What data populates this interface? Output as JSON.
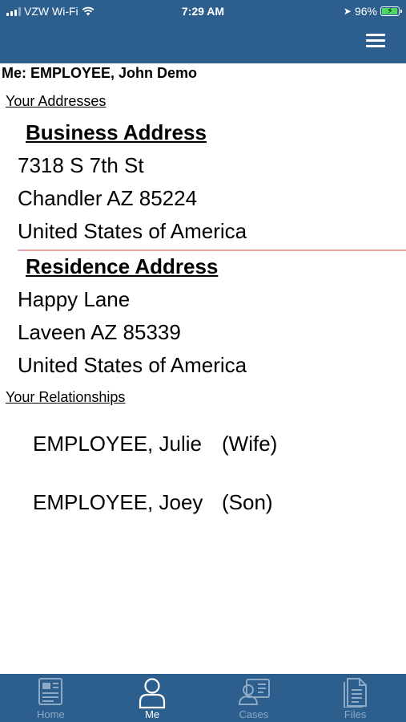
{
  "status_bar": {
    "carrier": "VZW Wi-Fi",
    "time": "7:29 AM",
    "battery": "96%",
    "battery_level": 0.96
  },
  "header": {
    "menu_icon": "hamburger-menu-icon",
    "bg_color": "#2c5f8d"
  },
  "me": {
    "title": "Me: EMPLOYEE, John Demo"
  },
  "addresses": {
    "section_label": "Your Addresses",
    "business": {
      "heading": "Business Address",
      "line1": "7318 S 7th St",
      "line2": "Chandler AZ 85224",
      "line3": "United States of America"
    },
    "residence": {
      "heading": "Residence Address",
      "line1": "Happy Lane",
      "line2": "Laveen AZ 85339",
      "line3": "United States of America"
    }
  },
  "relationships": {
    "section_label": "Your Relationships",
    "items": [
      {
        "name": "EMPLOYEE, Julie",
        "relation": "(Wife)"
      },
      {
        "name": "EMPLOYEE, Joey",
        "relation": "(Son)"
      }
    ]
  },
  "tabs": [
    {
      "label": "Home",
      "icon": "document-icon",
      "active": false
    },
    {
      "label": "Me",
      "icon": "person-icon",
      "active": true
    },
    {
      "label": "Cases",
      "icon": "id-card-icon",
      "active": false
    },
    {
      "label": "Files",
      "icon": "file-icon",
      "active": false
    }
  ],
  "colors": {
    "brand": "#2c5f8d",
    "divider": "#e8a0a0",
    "tab_inactive": "#8ea9c4",
    "tab_active": "#ffffff"
  }
}
